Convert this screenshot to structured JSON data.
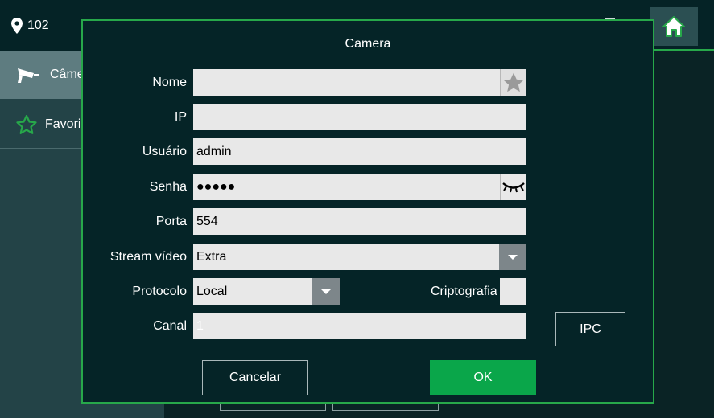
{
  "topbar": {
    "room_number": "102"
  },
  "sidebar": {
    "items": [
      {
        "label": "Câme"
      },
      {
        "label": "Favori"
      }
    ]
  },
  "modal": {
    "title": "Camera",
    "fields": {
      "name": {
        "label": "Nome",
        "value": ""
      },
      "ip": {
        "label": "IP",
        "value": ""
      },
      "user": {
        "label": "Usuário",
        "value": "admin"
      },
      "password": {
        "label": "Senha",
        "value": "●●●●●"
      },
      "port": {
        "label": "Porta",
        "value": "554"
      },
      "stream": {
        "label": "Stream vídeo",
        "value": "Extra"
      },
      "protocol": {
        "label": "Protocolo",
        "value": "Local"
      },
      "encryption": {
        "label": "Criptografia"
      },
      "channel": {
        "label": "Canal",
        "value": "1"
      }
    },
    "ipc_label": "IPC",
    "cancel_label": "Cancelar",
    "ok_label": "OK"
  },
  "colors": {
    "accent": "#27a84a",
    "ok_button": "#0aa64a",
    "background": "#052427"
  }
}
